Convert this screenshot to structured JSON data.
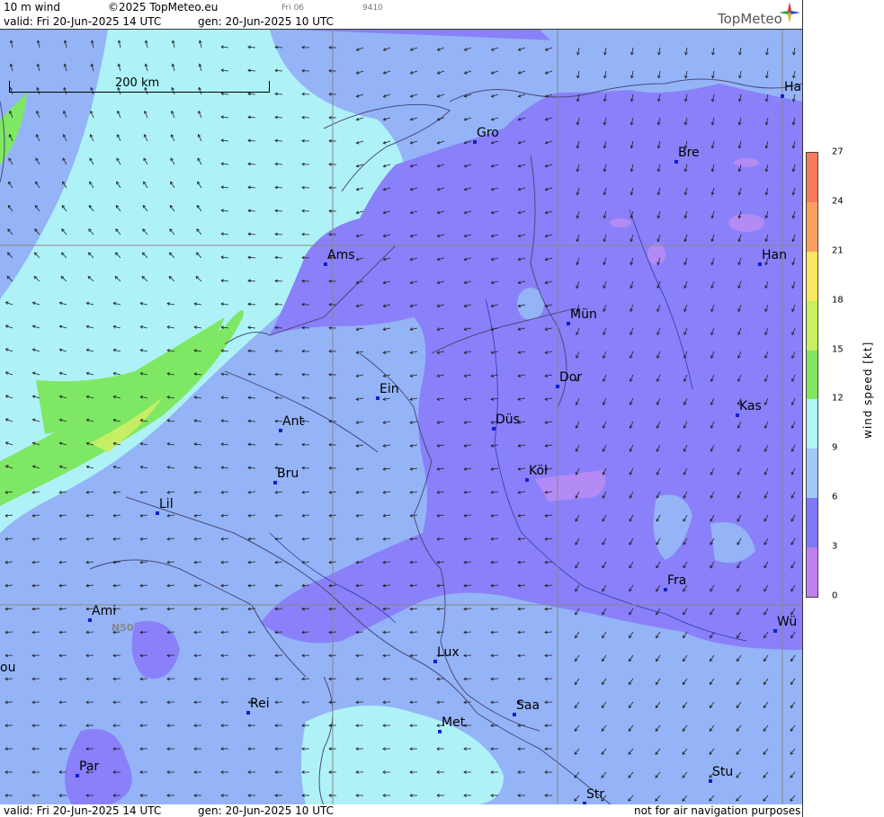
{
  "header": {
    "product": "10 m wind",
    "copyright": "©2025 TopMeteo.eu",
    "valid": "valid:  Fri  20-Jun-2025  14 UTC",
    "generated": "gen: 20-Jun-2025 10 UTC",
    "run": "Fri 06",
    "code": "9410",
    "brand": "TopMeteo"
  },
  "footer": {
    "valid": "valid:  Fri  20-Jun-2025  14 UTC",
    "generated": "gen: 20-Jun-2025 10 UTC",
    "disclaimer": "not for air navigation purposes"
  },
  "map": {
    "scale_label": "200 km",
    "latitude_label": "N50",
    "cities": [
      {
        "name": "Gro"
      },
      {
        "name": "Bre"
      },
      {
        "name": "Ha"
      },
      {
        "name": "Ams"
      },
      {
        "name": "Han"
      },
      {
        "name": "Mün"
      },
      {
        "name": "Ein"
      },
      {
        "name": "Dor"
      },
      {
        "name": "Ant"
      },
      {
        "name": "Düs"
      },
      {
        "name": "Kas"
      },
      {
        "name": "Bru"
      },
      {
        "name": "Köl"
      },
      {
        "name": "Lil"
      },
      {
        "name": "Fra"
      },
      {
        "name": "Ami"
      },
      {
        "name": "Wü"
      },
      {
        "name": "ou"
      },
      {
        "name": "Lux"
      },
      {
        "name": "Rei"
      },
      {
        "name": "Saa"
      },
      {
        "name": "Met"
      },
      {
        "name": "Par"
      },
      {
        "name": "Stu"
      },
      {
        "name": "Str"
      }
    ]
  },
  "legend": {
    "title": "wind  speed  [kt]",
    "ticks": [
      "27",
      "24",
      "21",
      "18",
      "15",
      "12",
      "9",
      "6",
      "3",
      "0"
    ],
    "colors": [
      "#f77a5a",
      "#f9a060",
      "#fbe860",
      "#c8f060",
      "#80e860",
      "#b0f8f8",
      "#a0c8f8",
      "#8078f8",
      "#c080f0"
    ]
  },
  "colors": {
    "purple": "#8a80fa",
    "light_purple": "#b48af5",
    "blue": "#94b4f7",
    "cyan": "#aef2f7",
    "green": "#7ee864",
    "yellowgreen": "#c6ee64",
    "pink": "#d78ef2"
  }
}
